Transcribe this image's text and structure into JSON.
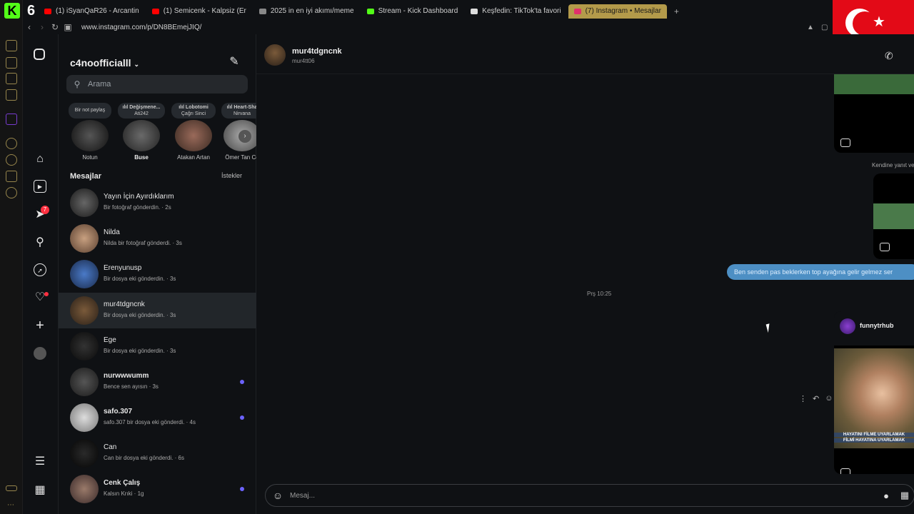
{
  "browser": {
    "logo": "K",
    "badge_num": "6",
    "tabs": [
      {
        "label": "(1) iSyanQaR26 - Arcantin",
        "color": "#ff0000"
      },
      {
        "label": "(1) Semicenk - Kalpsiz (Er",
        "color": "#ff0000"
      },
      {
        "label": "2025 in en iyi akımı/meme",
        "color": "#888888"
      },
      {
        "label": "Stream - Kick Dashboard",
        "color": "#53fc18"
      },
      {
        "label": "Keşfedin: TikTok'ta favori",
        "color": "#dddddd"
      },
      {
        "label": "(7) Instagram • Mesajlar",
        "color": "#e1306c",
        "active": true
      }
    ],
    "new_tab": "+",
    "url": "www.instagram.com/p/DN8BEmejJIQ/"
  },
  "sidebar": {
    "badge_count": "7",
    "icons": [
      "instagram-icon",
      "home-icon",
      "reels-icon",
      "messages-icon",
      "search-icon",
      "explore-icon",
      "heart-icon",
      "plus-icon",
      "profile-icon",
      "menu-icon",
      "apps-icon"
    ]
  },
  "inbox": {
    "account": "c4noofficialll",
    "search_placeholder": "Arama",
    "section_title": "Mesajlar",
    "requests_label": "İstekler",
    "stories": [
      {
        "note": "Bir not paylaş",
        "sub": "",
        "name": "Notun",
        "bold": false
      },
      {
        "note": "ılıl Değişmene...",
        "sub": "Ati242",
        "name": "Buse",
        "bold": true
      },
      {
        "note": "ılıl Lobotomi",
        "sub": "Çağrı Sinci",
        "name": "Atakan Artan",
        "bold": false
      },
      {
        "note": "ılıl Heart-Sha",
        "sub": "Nirvana",
        "name": "Ömer Tan Co",
        "bold": false
      }
    ],
    "conversations": [
      {
        "name": "Yayın İçin Ayırdıklarım",
        "preview": "Bir fotoğraf gönderdin. · 2s",
        "unread": false,
        "bold": false,
        "active": false
      },
      {
        "name": "Nilda",
        "preview": "Nilda bir fotoğraf gönderdi. · 3s",
        "unread": false,
        "bold": false,
        "active": false
      },
      {
        "name": "Erenyunusp",
        "preview": "Bir dosya eki gönderdin. · 3s",
        "unread": false,
        "bold": false,
        "active": false
      },
      {
        "name": "mur4tdgncnk",
        "preview": "Bir dosya eki gönderdin. · 3s",
        "unread": false,
        "bold": false,
        "active": true
      },
      {
        "name": "Ege",
        "preview": "Bir dosya eki gönderdin. · 3s",
        "unread": false,
        "bold": false,
        "active": false
      },
      {
        "name": "nurwwwumm",
        "preview": "Bence sen ayısın · 3s",
        "unread": true,
        "bold": true,
        "active": false
      },
      {
        "name": "safo.307",
        "preview": "safo.307 bir dosya eki gönderdi. · 4s",
        "unread": true,
        "bold": true,
        "active": false
      },
      {
        "name": "Can",
        "preview": "Can bir dosya eki gönderdi. · 6s",
        "unread": false,
        "bold": false,
        "active": false
      },
      {
        "name": "Cenk Çalış",
        "preview": "Kalsın Krıki · 1g",
        "unread": true,
        "bold": true,
        "active": false
      }
    ]
  },
  "chat": {
    "name": "mur4tdgncnk",
    "username": "mur4tt06",
    "reply_note": "Kendine yanıt ve",
    "outgoing_message": "Ben senden pas beklerken top ayağına gelir gelmez ser",
    "timestamp": "Prş 10:25",
    "shared_post_account": "funnytrhub",
    "caption_line1": "HAYATINI FİLME UYARLAMAK",
    "caption_line2": "FİLMİ HAYATINA UYARLAMAK",
    "composer_placeholder": "Mesaj..."
  }
}
